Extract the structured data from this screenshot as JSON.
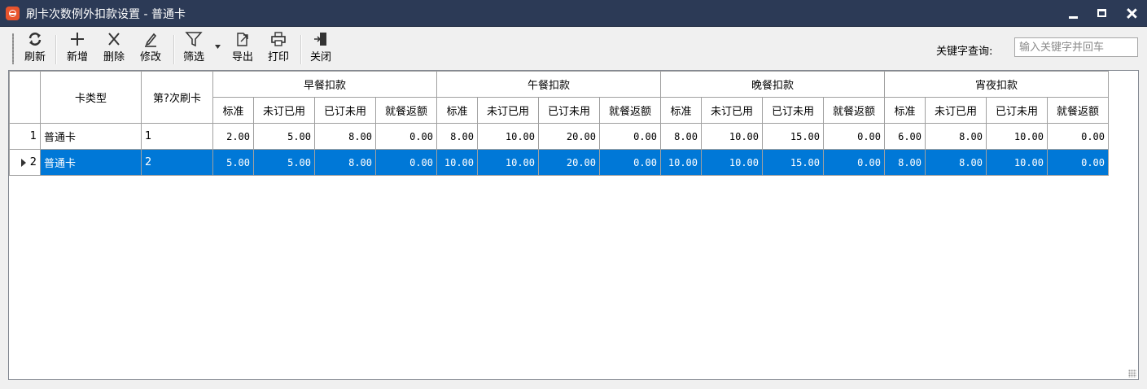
{
  "window": {
    "title": "刷卡次数例外扣款设置 - 普通卡"
  },
  "toolbar": {
    "refresh_label": "刷新",
    "add_label": "新增",
    "delete_label": "删除",
    "edit_label": "修改",
    "filter_label": "筛选",
    "export_label": "导出",
    "print_label": "打印",
    "close_label": "关闭",
    "search_label": "关键字查询:",
    "search_placeholder": "输入关键字并回车"
  },
  "grid": {
    "headers": {
      "card_type": "卡类型",
      "swipe_no": "第?次刷卡",
      "groups": [
        "早餐扣款",
        "午餐扣款",
        "晚餐扣款",
        "宵夜扣款"
      ],
      "sub": [
        "标准",
        "未订已用",
        "已订未用",
        "就餐返额"
      ]
    },
    "rows": [
      {
        "row_no": "1",
        "card_type": "普通卡",
        "swipe_no": "1",
        "values": [
          "2.00",
          "5.00",
          "8.00",
          "0.00",
          "8.00",
          "10.00",
          "20.00",
          "0.00",
          "8.00",
          "10.00",
          "15.00",
          "0.00",
          "6.00",
          "8.00",
          "10.00",
          "0.00"
        ],
        "selected": false
      },
      {
        "row_no": "2",
        "card_type": "普通卡",
        "swipe_no": "2",
        "values": [
          "5.00",
          "5.00",
          "8.00",
          "0.00",
          "10.00",
          "10.00",
          "20.00",
          "0.00",
          "10.00",
          "10.00",
          "15.00",
          "0.00",
          "8.00",
          "8.00",
          "10.00",
          "0.00"
        ],
        "selected": true
      }
    ]
  },
  "colors": {
    "titlebar": "#2c3a56",
    "selection": "#0078d7"
  }
}
